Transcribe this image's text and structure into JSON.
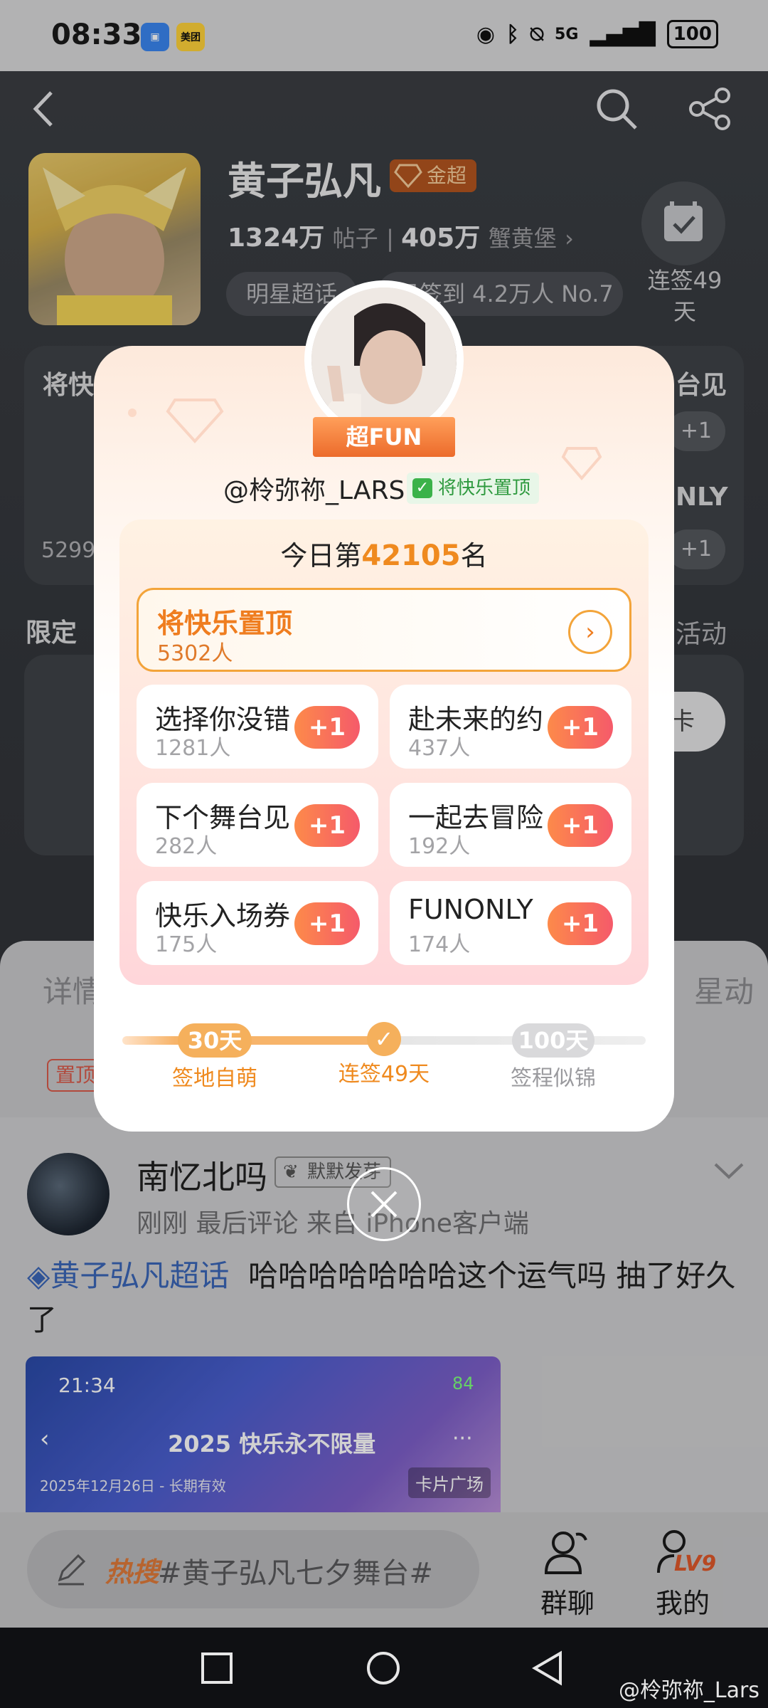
{
  "status_bar": {
    "time": "08:33",
    "apps": [
      "App Market",
      "美团"
    ],
    "network": "5G",
    "battery": "100"
  },
  "header": {
    "title": "黄子弘凡",
    "badge": "金超",
    "posts_count": "1324万",
    "posts_label": "帖子",
    "fans_count": "405万",
    "fans_label": "蟹黄堡",
    "chip_category": "明星超话",
    "chip_signin": "日签到 4.2万人 No.7",
    "signin_streak": "连签49天"
  },
  "background_card": {
    "left_title": "将快",
    "right_title": "台见",
    "right_label2": "NLY",
    "plus": "+1",
    "count_left": "5299",
    "section_title": "限定",
    "section_link": "活动",
    "section_btn": "卡"
  },
  "modal": {
    "fun_label": "超FUN",
    "username": "@柃弥祢_LARS",
    "user_tag": "将快乐置顶",
    "rank_prefix": "今日第",
    "rank_number": "42105",
    "rank_suffix": "名",
    "top_option": {
      "name": "将快乐置顶",
      "count": "5302人"
    },
    "options": [
      {
        "name": "选择你没错",
        "count": "1281人",
        "plus": "+1"
      },
      {
        "name": "赴未来的约",
        "count": "437人",
        "plus": "+1"
      },
      {
        "name": "下个舞台见",
        "count": "282人",
        "plus": "+1"
      },
      {
        "name": "一起去冒险",
        "count": "192人",
        "plus": "+1"
      },
      {
        "name": "快乐入场券",
        "count": "175人",
        "plus": "+1"
      },
      {
        "name": "FUNONLY",
        "count": "174人",
        "plus": "+1"
      }
    ],
    "progress": {
      "value_days": 49,
      "milestones": [
        {
          "badge": "30天",
          "label": "签地自萌"
        },
        {
          "badge": "",
          "label": "连签49天"
        },
        {
          "badge": "100天",
          "label": "签程似锦"
        }
      ]
    }
  },
  "sheet": {
    "tab_detail": "详情",
    "tab_star": "星动",
    "pinned_tag": "置顶"
  },
  "post": {
    "author": "南忆北吗",
    "author_badge": "默默发芽",
    "meta": "刚刚  最后评论   来自 iPhone客户端",
    "topic": "黄子弘凡超话",
    "text": "哈哈哈哈哈哈哈这个运气吗 抽了好久了",
    "image_time": "21:34",
    "image_battery": "84",
    "image_title": "2025 快乐永不限量",
    "image_date": "2025年12月26日 - 长期有效",
    "image_tag": "卡片广场"
  },
  "bottom_bar": {
    "hot_label": "热搜",
    "search_text": "#黄子弘凡七夕舞台#",
    "nav_chat": "群聊",
    "nav_me": "我的",
    "level": "LV9"
  },
  "watermark": "@柃弥祢_Lars",
  "colors": {
    "accent": "#ef8a1f",
    "plus_gradient_start": "#fd8a4a",
    "plus_gradient_end": "#f55a6a",
    "topic": "#3a66b8"
  }
}
